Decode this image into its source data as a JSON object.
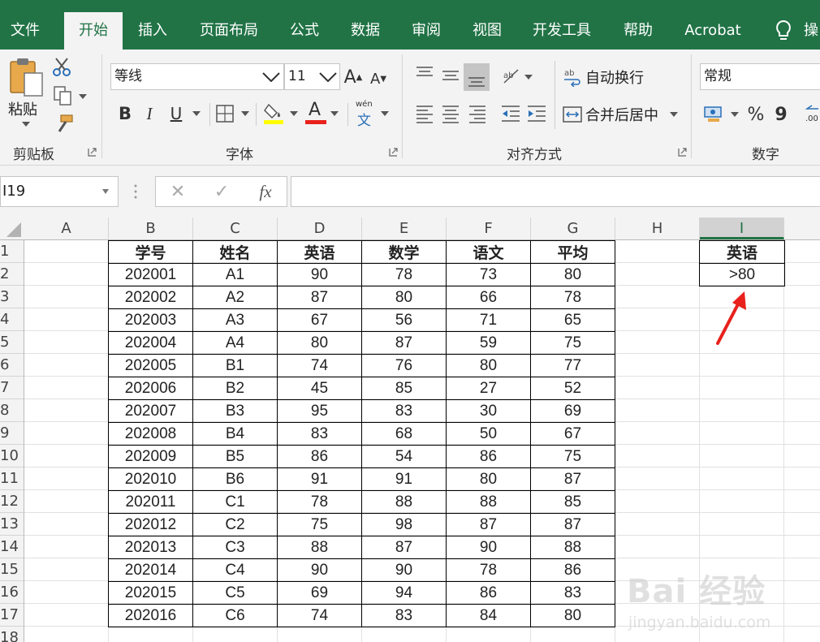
{
  "colors": {
    "brand": "#217346",
    "ribbon_bg": "#f3f3f3",
    "annotation_arrow": "#e8211c",
    "fill_highlight": "#ffff00",
    "font_color_bar": "#e8211c"
  },
  "tabs": [
    "文件",
    "开始",
    "插入",
    "页面布局",
    "公式",
    "数据",
    "审阅",
    "视图",
    "开发工具",
    "帮助",
    "Acrobat"
  ],
  "active_tab": "开始",
  "tell_me": {
    "icon": "lightbulb-icon",
    "text": "操"
  },
  "ribbon": {
    "clipboard": {
      "label": "剪贴板",
      "paste_label": "粘贴",
      "icons": [
        "paste-icon",
        "cut-icon",
        "copy-icon",
        "format-painter-icon"
      ]
    },
    "font": {
      "label": "字体",
      "font_name": "等线",
      "font_size": "11",
      "bold": "B",
      "italic": "I",
      "underline": "U",
      "font_color_letter": "A",
      "phonetic_top": "wén",
      "phonetic_char": "文",
      "grow_letter": "A",
      "shrink_letter": "A"
    },
    "alignment": {
      "label": "对齐方式",
      "wrap_text": "自动换行",
      "merge_center": "合并后居中"
    },
    "number": {
      "label": "数字",
      "format": "常规",
      "percent": "%",
      "comma": "9"
    }
  },
  "formula_bar": {
    "name_box": "I19",
    "cancel": "✕",
    "enter": "✓",
    "fx": "fx",
    "formula": ""
  },
  "sheet": {
    "columns": [
      "A",
      "B",
      "C",
      "D",
      "E",
      "F",
      "G",
      "H",
      "I"
    ],
    "selected_column": "I",
    "rows": [
      "1",
      "2",
      "3",
      "4",
      "5",
      "6",
      "7",
      "8",
      "9",
      "10",
      "11",
      "12",
      "13",
      "14",
      "15",
      "16",
      "17",
      "18"
    ],
    "table_header": [
      "学号",
      "姓名",
      "英语",
      "数学",
      "语文",
      "平均"
    ],
    "table_rows": [
      [
        "202001",
        "A1",
        "90",
        "78",
        "73",
        "80"
      ],
      [
        "202002",
        "A2",
        "87",
        "80",
        "66",
        "78"
      ],
      [
        "202003",
        "A3",
        "67",
        "56",
        "71",
        "65"
      ],
      [
        "202004",
        "A4",
        "80",
        "87",
        "59",
        "75"
      ],
      [
        "202005",
        "B1",
        "74",
        "76",
        "80",
        "77"
      ],
      [
        "202006",
        "B2",
        "45",
        "85",
        "27",
        "52"
      ],
      [
        "202007",
        "B3",
        "95",
        "83",
        "30",
        "69"
      ],
      [
        "202008",
        "B4",
        "83",
        "68",
        "50",
        "67"
      ],
      [
        "202009",
        "B5",
        "86",
        "54",
        "86",
        "75"
      ],
      [
        "202010",
        "B6",
        "91",
        "91",
        "80",
        "87"
      ],
      [
        "202011",
        "C1",
        "78",
        "88",
        "88",
        "85"
      ],
      [
        "202012",
        "C2",
        "75",
        "98",
        "87",
        "87"
      ],
      [
        "202013",
        "C3",
        "88",
        "87",
        "90",
        "88"
      ],
      [
        "202014",
        "C4",
        "90",
        "90",
        "78",
        "86"
      ],
      [
        "202015",
        "C5",
        "69",
        "94",
        "86",
        "83"
      ],
      [
        "202016",
        "C6",
        "74",
        "83",
        "84",
        "80"
      ]
    ],
    "criteria": {
      "header": "英语",
      "value": ">80"
    }
  },
  "watermark": {
    "brand": "Bai 经验",
    "url": "jingyan.baidu.com"
  }
}
